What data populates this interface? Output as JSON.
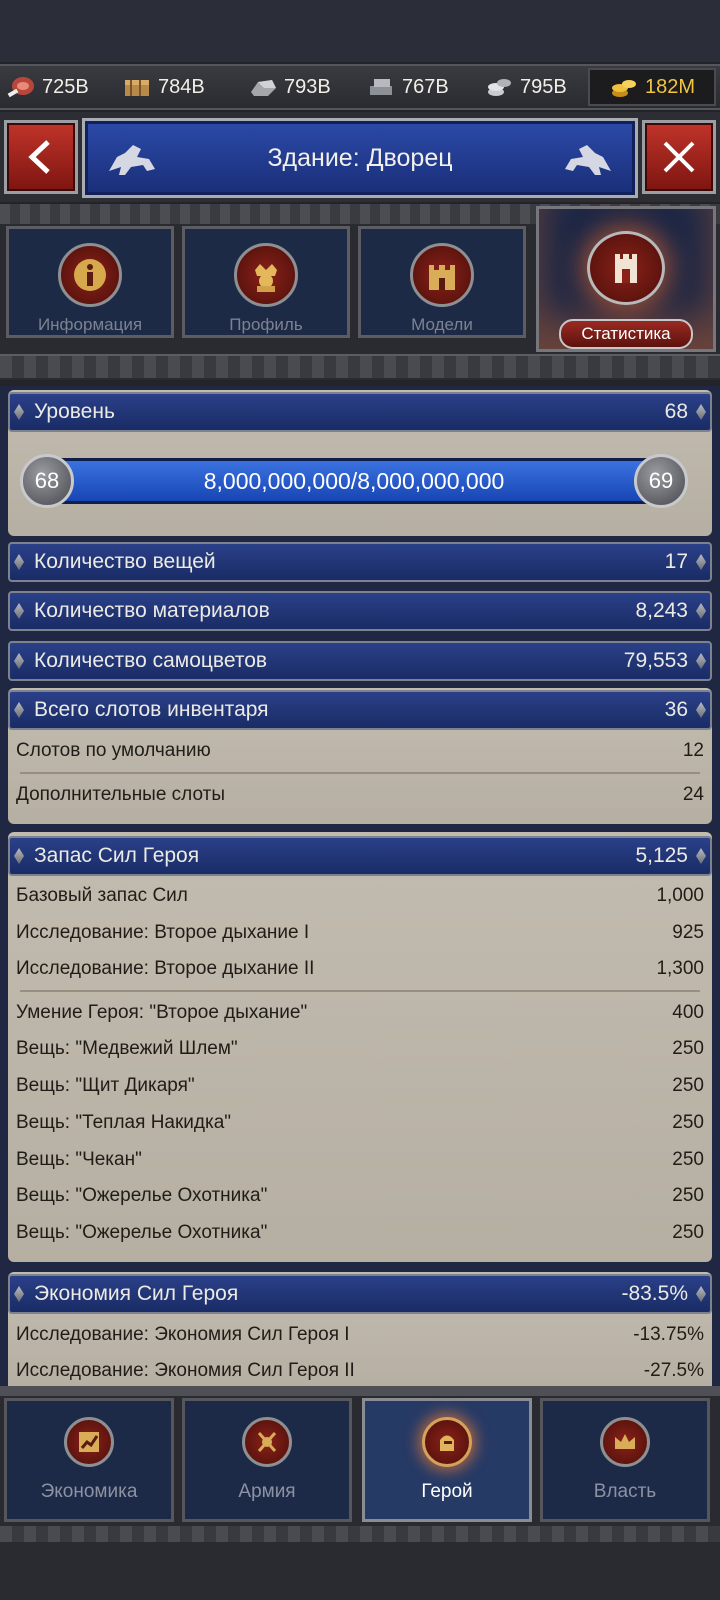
{
  "resources": {
    "meat": "725B",
    "wood": "784B",
    "stone": "793B",
    "iron": "767B",
    "silver": "795B",
    "gold": "182M"
  },
  "header": {
    "title": "Здание: Дворец"
  },
  "tabs": [
    {
      "label": "Информация",
      "icon": "info-icon"
    },
    {
      "label": "Профиль",
      "icon": "king-icon"
    },
    {
      "label": "Модели",
      "icon": "castle-icon"
    },
    {
      "label": "Статистика",
      "icon": "tower-icon",
      "active": true
    }
  ],
  "level": {
    "label": "Уровень",
    "value": "68",
    "progress_text": "8,000,000,000/8,000,000,000",
    "progress_fraction": 1.0,
    "current": "68",
    "next": "69"
  },
  "stats": {
    "items": {
      "label": "Количество вещей",
      "value": "17"
    },
    "materials": {
      "label": "Количество материалов",
      "value": "8,243"
    },
    "gems": {
      "label": "Количество самоцветов",
      "value": "79,553"
    },
    "inventory": {
      "label": "Всего слотов инвентаря",
      "value": "36",
      "rows": [
        {
          "label": "Слотов по умолчанию",
          "value": "12"
        },
        {
          "label": "Дополнительные слоты",
          "value": "24"
        }
      ]
    },
    "energy": {
      "label": "Запас Сил Героя",
      "value": "5,125",
      "rows": [
        {
          "label": "Базовый запас Сил",
          "value": "1,000"
        },
        {
          "label": "Исследование: Второе дыхание I",
          "value": "925"
        },
        {
          "label": "Исследование: Второе дыхание II",
          "value": "1,300"
        },
        {
          "label": "Умение Героя: \"Второе дыхание\"",
          "value": "400"
        },
        {
          "label": "Вещь: \"Медвежий Шлем\"",
          "value": "250"
        },
        {
          "label": "Вещь: \"Щит Дикаря\"",
          "value": "250"
        },
        {
          "label": "Вещь: \"Теплая Накидка\"",
          "value": "250"
        },
        {
          "label": "Вещь: \"Чекан\"",
          "value": "250"
        },
        {
          "label": "Вещь: \"Ожерелье Охотника\"",
          "value": "250"
        },
        {
          "label": "Вещь: \"Ожерелье Охотника\"",
          "value": "250"
        }
      ]
    },
    "economy": {
      "label": "Экономия Сил Героя",
      "value": "-83.5%",
      "rows": [
        {
          "label": "Исследование: Экономия Сил Героя I",
          "value": "-13.75%"
        },
        {
          "label": "Исследование: Экономия Сил Героя II",
          "value": "-27.5%"
        }
      ]
    }
  },
  "bottom_nav": [
    {
      "label": "Экономика",
      "icon": "economy-icon"
    },
    {
      "label": "Армия",
      "icon": "army-icon"
    },
    {
      "label": "Герой",
      "icon": "hero-icon",
      "active": true
    },
    {
      "label": "Власть",
      "icon": "crown-icon"
    }
  ],
  "colors": {
    "accent_red": "#a0251c",
    "banner_blue": "#1f3a8f",
    "parchment": "#bfb8ab",
    "gold": "#f2c440"
  }
}
